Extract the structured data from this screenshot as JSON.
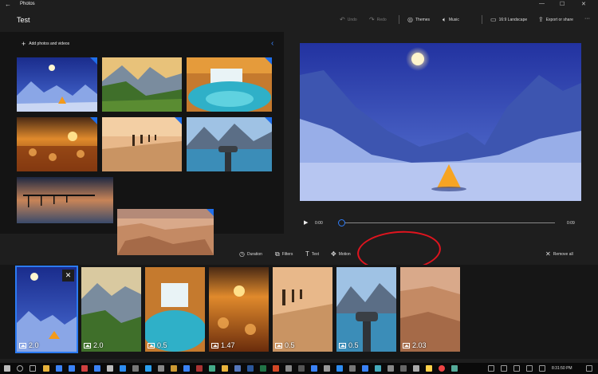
{
  "window": {
    "app_name": "Photos",
    "back_glyph": "←",
    "minimize_glyph": "—",
    "maximize_glyph": "☐",
    "close_glyph": "✕"
  },
  "header": {
    "project_title": "Test",
    "undo_label": "Undo",
    "redo_label": "Redo",
    "themes_label": "Themes",
    "music_label": "Music",
    "aspect_label": "16:9 Landscape",
    "export_label": "Export or share",
    "more_glyph": "···"
  },
  "library": {
    "add_label": "Add photos and videos",
    "collapse_glyph": "‹"
  },
  "player": {
    "play_glyph": "▶",
    "current_time": "0:00",
    "end_time": "0:09",
    "progress": 0.0
  },
  "storyboard_tools": {
    "duration_label": "Duration",
    "filters_label": "Filters",
    "text_label": "Text",
    "motion_label": "Motion",
    "remove_all_label": "Remove all"
  },
  "storyboard": {
    "close_glyph": "✕",
    "cards": [
      {
        "duration": "2.0"
      },
      {
        "duration": "2.0"
      },
      {
        "duration": "0.5"
      },
      {
        "duration": "1.47"
      },
      {
        "duration": "0.5"
      },
      {
        "duration": "0.5"
      },
      {
        "duration": "2.03"
      }
    ]
  },
  "taskbar": {
    "clock": "8:31:50 PM"
  },
  "colors": {
    "accent": "#2b7bf3",
    "annotation": "#e0141e",
    "background": "#1e1e1e"
  }
}
